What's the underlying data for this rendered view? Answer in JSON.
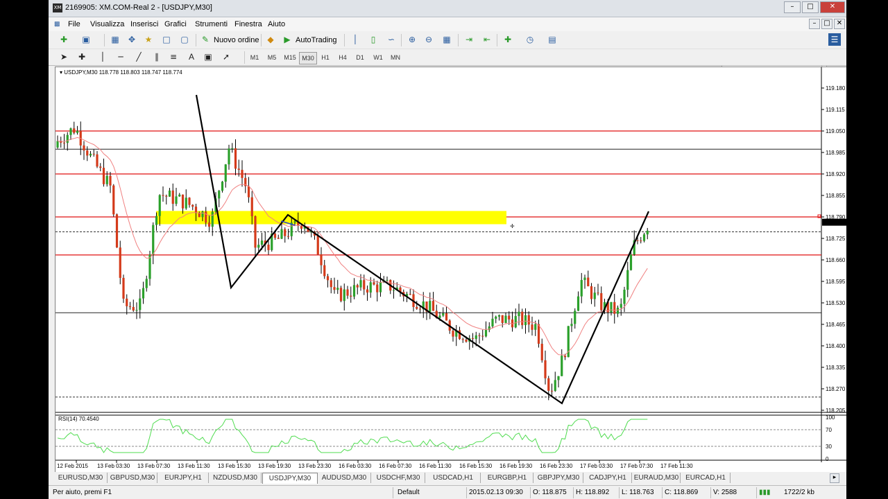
{
  "window": {
    "title": "2169905: XM.COM-Real 2 - [USDJPY,M30]",
    "app_icon_text": "XM",
    "controls": {
      "minimize": "–",
      "restore": "□",
      "close": "✕"
    },
    "inner_controls": {
      "minimize": "–",
      "restore": "□",
      "close": "✕"
    }
  },
  "menu": [
    "File",
    "Visualizza",
    "Inserisci",
    "Grafici",
    "Strumenti",
    "Finestra",
    "Aiuto"
  ],
  "toolbar": {
    "new_order_label": "Nuovo ordine",
    "autotrading_label": "AutoTrading"
  },
  "timeframes": [
    "M1",
    "M5",
    "M15",
    "M30",
    "H1",
    "H4",
    "D1",
    "W1",
    "MN"
  ],
  "active_timeframe": "M30",
  "chart": {
    "info": "USDJPY,M30  118.778 118.803 118.747 118.774",
    "current_price_label": "118.774",
    "price_ticks": [
      "119.180",
      "119.115",
      "119.050",
      "118.985",
      "118.920",
      "118.855",
      "118.790",
      "118.725",
      "118.660",
      "118.595",
      "118.530",
      "118.465",
      "118.400",
      "118.335",
      "118.270",
      "118.205"
    ],
    "time_ticks": [
      "12 Feb 2015",
      "13 Feb 03:30",
      "13 Feb 07:30",
      "13 Feb 11:30",
      "13 Feb 15:30",
      "13 Feb 19:30",
      "13 Feb 23:30",
      "16 Feb 03:30",
      "16 Feb 07:30",
      "16 Feb 11:30",
      "16 Feb 15:30",
      "16 Feb 19:30",
      "16 Feb 23:30",
      "17 Feb 03:30",
      "17 Feb 07:30",
      "17 Feb 11:30"
    ],
    "colors": {
      "bull": "#2ba02b",
      "bear": "#d43a1a",
      "ma": "#f08080",
      "level": "#e01010",
      "zone": "#ffff00",
      "rsi": "#4fdc4f"
    }
  },
  "rsi": {
    "label": "RSI(14) 70.4540",
    "ticks": [
      "100",
      "70",
      "30",
      "0"
    ]
  },
  "tabs": [
    "EURUSD,M30",
    "GBPUSD,M30",
    "EURJPY,H1",
    "NZDUSD,M30",
    "USDJPY,M30",
    "AUDUSD,M30",
    "USDCHF,M30",
    "USDCAD,H1",
    "EURGBP,H1",
    "GBPJPY,M30",
    "CADJPY,H1",
    "EURAUD,M30",
    "EURCAD,H1"
  ],
  "active_tab": "USDJPY,M30",
  "status": {
    "help": "Per aiuto, premi F1",
    "profile": "Default",
    "datetime": "2015.02.13 09:30",
    "open": "O: 118.875",
    "high": "H: 118.892",
    "low": "L: 118.763",
    "close": "C: 118.869",
    "volume": "V: 2588",
    "traffic": "1722/2 kb"
  }
}
